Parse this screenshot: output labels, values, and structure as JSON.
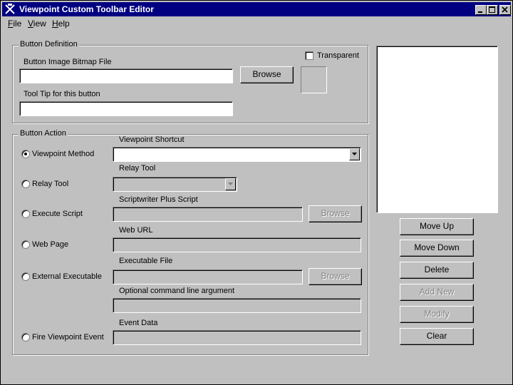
{
  "window": {
    "title": "Viewpoint Custom Toolbar Editor"
  },
  "titlebar_buttons": [
    "minimize",
    "maximize",
    "close"
  ],
  "menu": [
    {
      "label": "File",
      "accel": "F",
      "rest": "ile"
    },
    {
      "label": "View",
      "accel": "V",
      "rest": "iew"
    },
    {
      "label": "Help",
      "accel": "H",
      "rest": "elp"
    }
  ],
  "button_definition": {
    "group_title": "Button Definition",
    "bitmap_label": "Button Image Bitmap File",
    "bitmap_value": "",
    "browse_label": "Browse",
    "transparent_label": "Transparent",
    "transparent_checked": false,
    "tooltip_label": "Tool Tip for this button",
    "tooltip_value": ""
  },
  "button_action": {
    "group_title": "Button Action",
    "options": [
      {
        "label": "Viewpoint Method",
        "checked": true,
        "field_label": "Viewpoint Shortcut",
        "value": ""
      },
      {
        "label": "Relay Tool",
        "checked": false,
        "field_label": "Relay Tool",
        "value": ""
      },
      {
        "label": "Execute  Script",
        "checked": false,
        "field_label": "Scriptwriter Plus Script",
        "value": "",
        "browse": "Browse"
      },
      {
        "label": "Web Page",
        "checked": false,
        "field_label": "Web URL",
        "value": ""
      },
      {
        "label": "External Executable",
        "checked": false,
        "field_label": "Executable File",
        "value": "",
        "browse": "Browse",
        "extra_label": "Optional command line argument"
      },
      {
        "label": "Fire Viewpoint Event",
        "checked": false,
        "field_label": "Event Data",
        "value": ""
      }
    ]
  },
  "side_buttons": {
    "move_up": "Move Up",
    "move_down": "Move Down",
    "delete": "Delete",
    "add_new": "Add New",
    "modify": "Modify",
    "clear": "Clear"
  },
  "colors": {
    "title_bg": "#000080",
    "face": "#c0c0c0",
    "disabled_text": "#808080"
  }
}
